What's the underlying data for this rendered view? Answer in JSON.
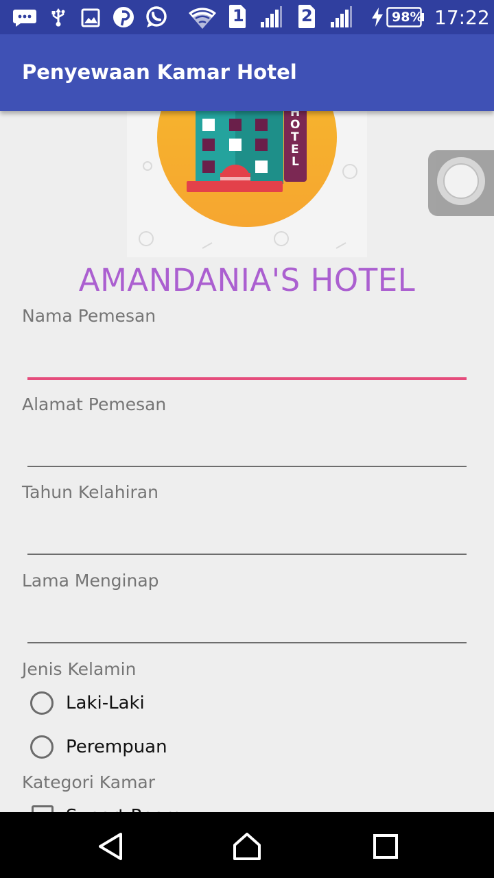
{
  "status_bar": {
    "time": "17:22",
    "battery": "98%",
    "sim1": "1",
    "sim2": "2",
    "icons": [
      "messages-icon",
      "usb-icon",
      "image-icon",
      "pinterest-icon",
      "whatsapp-icon",
      "wifi-icon",
      "sim1-signal-icon",
      "sim2-signal-icon",
      "charging-icon",
      "battery-icon"
    ]
  },
  "app_bar": {
    "title": "Penyewaan Kamar Hotel"
  },
  "hero": {
    "sign_letters": [
      "H",
      "O",
      "T",
      "E",
      "L"
    ]
  },
  "hotel_name": "AMANDANIA'S HOTEL",
  "form": {
    "nama_label": "Nama Pemesan",
    "nama_value": "",
    "alamat_label": "Alamat Pemesan",
    "alamat_value": "",
    "tahun_label": "Tahun Kelahiran",
    "tahun_value": "",
    "lama_label": "Lama Menginap",
    "lama_value": "",
    "gender_label": "Jenis Kelamin",
    "gender_options": [
      "Laki-Laki",
      "Perempuan"
    ],
    "kategori_label": "Kategori Kamar",
    "kategori_first_option": "Suport Room"
  },
  "colors": {
    "status_bar": "#303f9f",
    "app_bar": "#3f51b5",
    "accent": "#e54c7c",
    "hotel_name": "#ab5fd0",
    "background": "#eeeeee"
  },
  "nav": {
    "icons": [
      "back-icon",
      "home-icon",
      "recents-icon"
    ]
  }
}
